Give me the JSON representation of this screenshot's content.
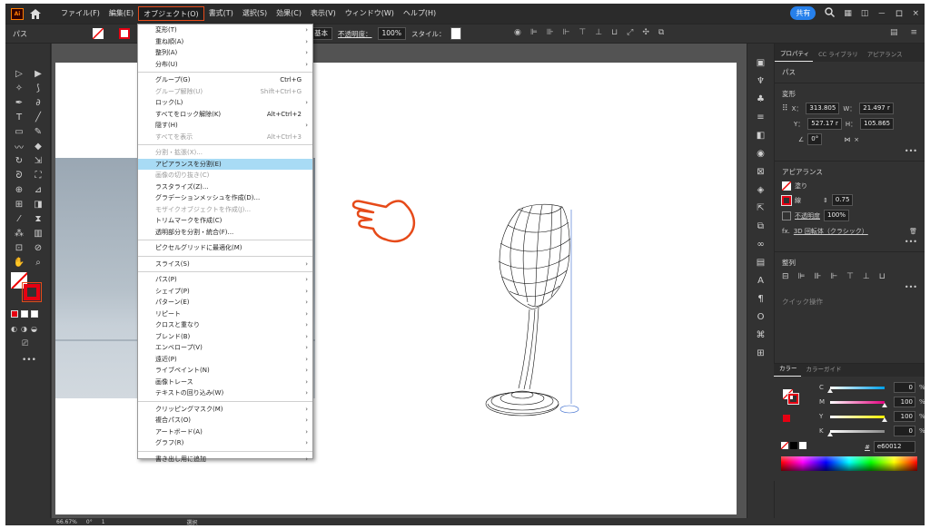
{
  "menubar": {
    "logo": "Ai",
    "items": [
      {
        "label": "ファイル(F)",
        "active": false
      },
      {
        "label": "編集(E)",
        "active": false
      },
      {
        "label": "オブジェクト(O)",
        "active": true
      },
      {
        "label": "書式(T)",
        "active": false
      },
      {
        "label": "選択(S)",
        "active": false
      },
      {
        "label": "効果(C)",
        "active": false
      },
      {
        "label": "表示(V)",
        "active": false
      },
      {
        "label": "ウィンドウ(W)",
        "active": false
      },
      {
        "label": "ヘルプ(H)",
        "active": false
      }
    ],
    "share_label": "共有",
    "window_controls": [
      "－",
      "ロ",
      "×"
    ]
  },
  "controlbar": {
    "object_type": "パス",
    "stroke_profile": "基本",
    "opacity_label": "不透明度：",
    "opacity_value": "100%",
    "style_label": "スタイル："
  },
  "dropdown": {
    "items": [
      {
        "label": "変形(T)",
        "shortcut": "",
        "submenu": true,
        "disabled": false
      },
      {
        "label": "重ね順(A)",
        "shortcut": "",
        "submenu": true,
        "disabled": false
      },
      {
        "label": "整列(A)",
        "shortcut": "",
        "submenu": true,
        "disabled": false
      },
      {
        "label": "分布(U)",
        "shortcut": "",
        "submenu": true,
        "disabled": false
      },
      {
        "sep": true
      },
      {
        "label": "グループ(G)",
        "shortcut": "Ctrl+G",
        "submenu": false,
        "disabled": false
      },
      {
        "label": "グループ解除(U)",
        "shortcut": "Shift+Ctrl+G",
        "submenu": false,
        "disabled": true
      },
      {
        "label": "ロック(L)",
        "shortcut": "",
        "submenu": true,
        "disabled": false
      },
      {
        "label": "すべてをロック解除(K)",
        "shortcut": "Alt+Ctrl+2",
        "submenu": false,
        "disabled": false
      },
      {
        "label": "隠す(H)",
        "shortcut": "",
        "submenu": true,
        "disabled": false
      },
      {
        "label": "すべてを表示",
        "shortcut": "Alt+Ctrl+3",
        "submenu": false,
        "disabled": true
      },
      {
        "sep": true
      },
      {
        "label": "分割・拡張(X)...",
        "shortcut": "",
        "submenu": false,
        "disabled": true
      },
      {
        "label": "アピアランスを分割(E)",
        "shortcut": "",
        "submenu": false,
        "disabled": false,
        "highlight": true
      },
      {
        "label": "画像の切り抜き(C)",
        "shortcut": "",
        "submenu": false,
        "disabled": true
      },
      {
        "label": "ラスタライズ(Z)...",
        "shortcut": "",
        "submenu": false,
        "disabled": false
      },
      {
        "label": "グラデーションメッシュを作成(D)...",
        "shortcut": "",
        "submenu": false,
        "disabled": false
      },
      {
        "label": "モザイクオブジェクトを作成(J)...",
        "shortcut": "",
        "submenu": false,
        "disabled": true
      },
      {
        "label": "トリムマークを作成(C)",
        "shortcut": "",
        "submenu": false,
        "disabled": false
      },
      {
        "label": "透明部分を分割・統合(F)...",
        "shortcut": "",
        "submenu": false,
        "disabled": false
      },
      {
        "sep": true
      },
      {
        "label": "ピクセルグリッドに最適化(M)",
        "shortcut": "",
        "submenu": false,
        "disabled": false
      },
      {
        "sep": true
      },
      {
        "label": "スライス(S)",
        "shortcut": "",
        "submenu": true,
        "disabled": false
      },
      {
        "sep": true
      },
      {
        "label": "パス(P)",
        "shortcut": "",
        "submenu": true,
        "disabled": false
      },
      {
        "label": "シェイプ(P)",
        "shortcut": "",
        "submenu": true,
        "disabled": false
      },
      {
        "label": "パターン(E)",
        "shortcut": "",
        "submenu": true,
        "disabled": false
      },
      {
        "label": "リピート",
        "shortcut": "",
        "submenu": true,
        "disabled": false
      },
      {
        "label": "クロスと重なり",
        "shortcut": "",
        "submenu": true,
        "disabled": false
      },
      {
        "label": "ブレンド(B)",
        "shortcut": "",
        "submenu": true,
        "disabled": false
      },
      {
        "label": "エンベロープ(V)",
        "shortcut": "",
        "submenu": true,
        "disabled": false
      },
      {
        "label": "遠近(P)",
        "shortcut": "",
        "submenu": true,
        "disabled": false
      },
      {
        "label": "ライブペイント(N)",
        "shortcut": "",
        "submenu": true,
        "disabled": false
      },
      {
        "label": "画像トレース",
        "shortcut": "",
        "submenu": true,
        "disabled": false
      },
      {
        "label": "テキストの回り込み(W)",
        "shortcut": "",
        "submenu": true,
        "disabled": false
      },
      {
        "sep": true
      },
      {
        "label": "クリッピングマスク(M)",
        "shortcut": "",
        "submenu": true,
        "disabled": false
      },
      {
        "label": "複合パス(O)",
        "shortcut": "",
        "submenu": true,
        "disabled": false
      },
      {
        "label": "アートボード(A)",
        "shortcut": "",
        "submenu": true,
        "disabled": false
      },
      {
        "label": "グラフ(R)",
        "shortcut": "",
        "submenu": true,
        "disabled": false
      },
      {
        "sep": true
      },
      {
        "label": "書き出し用に追加",
        "shortcut": "",
        "submenu": true,
        "disabled": false
      }
    ]
  },
  "properties": {
    "tabs": [
      "プロパティ",
      "CC ライブラリ",
      "アピアランス"
    ],
    "selection": "パス",
    "transform_title": "変形",
    "x_label": "X：",
    "x_value": "313.805",
    "y_label": "Y：",
    "y_value": "527.17 r",
    "w_label": "W：",
    "w_value": "21.497 r",
    "h_label": "H：",
    "h_value": "105.865",
    "angle_value": "0°",
    "appearance_title": "アピアランス",
    "fill_label": "塗り",
    "stroke_label": "線",
    "stroke_value": "0.75",
    "opacity_label": "不透明度",
    "opacity_value": "100%",
    "effect_prefix": "fx.",
    "effect_label": "3D 回転体（クラシック）",
    "align_title": "整列",
    "quick_actions_title": "クイック操作"
  },
  "color_panel": {
    "tabs": [
      "カラー",
      "カラーガイド"
    ],
    "channels": [
      {
        "label": "C",
        "value": "0",
        "color": "#00a0e9",
        "fill": 0.0
      },
      {
        "label": "M",
        "value": "100",
        "color": "#e4007f",
        "fill": 1.0
      },
      {
        "label": "Y",
        "value": "100",
        "color": "#fff100",
        "fill": 1.0
      },
      {
        "label": "K",
        "value": "0",
        "color": "#888888",
        "fill": 0.0
      }
    ],
    "percent_sign": "%",
    "hex_prefix": "#",
    "hex_value": "e60012"
  },
  "statusbar": {
    "zoom": "66.67%",
    "rotation": "0°",
    "artboard": "1",
    "tool": "選択"
  },
  "colors": {
    "accent_highlight": "#e64a19",
    "stroke_red": "#e60012",
    "menu_highlight": "#a8dbf5",
    "share_blue": "#2680eb"
  }
}
